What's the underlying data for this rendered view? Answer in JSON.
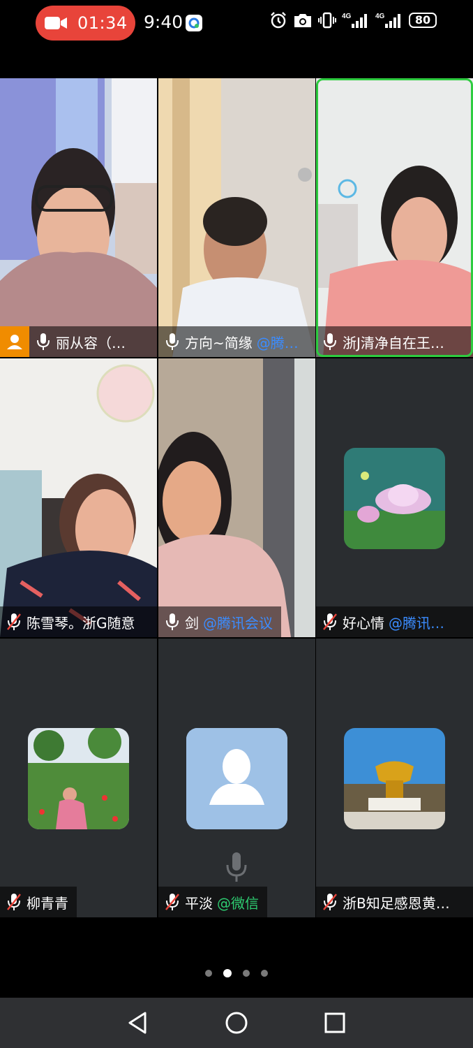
{
  "status_bar": {
    "recording_time": "01:34",
    "clock": "9:40",
    "battery": "80",
    "icons": [
      "video-camera-icon",
      "meeting-app-icon",
      "alarm-icon",
      "camera-icon",
      "vibrate-icon",
      "signal-4g-icon",
      "signal-4g-icon",
      "battery-icon"
    ]
  },
  "participants": [
    {
      "name": "丽从容（…",
      "via": "",
      "mic": "on",
      "host": true,
      "active": false,
      "video": "photo"
    },
    {
      "name": "方向~简缘",
      "via": "@腾…",
      "mic": "on",
      "host": false,
      "active": false,
      "video": "photo"
    },
    {
      "name": "浙J清净自在王…",
      "via": "",
      "mic": "on",
      "host": false,
      "active": true,
      "video": "photo"
    },
    {
      "name": "陈雪琴。浙G随意",
      "via": "",
      "mic": "muted",
      "host": false,
      "active": false,
      "video": "photo"
    },
    {
      "name": "剑",
      "via": "@腾讯会议",
      "mic": "on",
      "host": false,
      "active": false,
      "video": "photo"
    },
    {
      "name": "好心情",
      "via": "@腾讯…",
      "mic": "muted",
      "host": false,
      "active": false,
      "video": "avatar-flower"
    },
    {
      "name": "柳青青",
      "via": "",
      "mic": "muted",
      "host": false,
      "active": false,
      "video": "avatar-garden"
    },
    {
      "name": "平淡",
      "via": "@微信",
      "mic": "muted",
      "host": false,
      "active": false,
      "video": "avatar-default"
    },
    {
      "name": "浙B知足感恩黄…",
      "via": "",
      "mic": "muted",
      "host": false,
      "active": false,
      "video": "avatar-golden"
    }
  ],
  "pagination": {
    "pages": 4,
    "current": 2
  },
  "nav": {
    "icons": [
      "back-icon",
      "home-icon",
      "recents-icon"
    ]
  },
  "colors": {
    "active_speaker": "#2ecc40",
    "host_badge": "#f08c00",
    "recording": "#e8443a",
    "via_link": "#3b8cff",
    "via_wechat": "#2ecc71"
  }
}
